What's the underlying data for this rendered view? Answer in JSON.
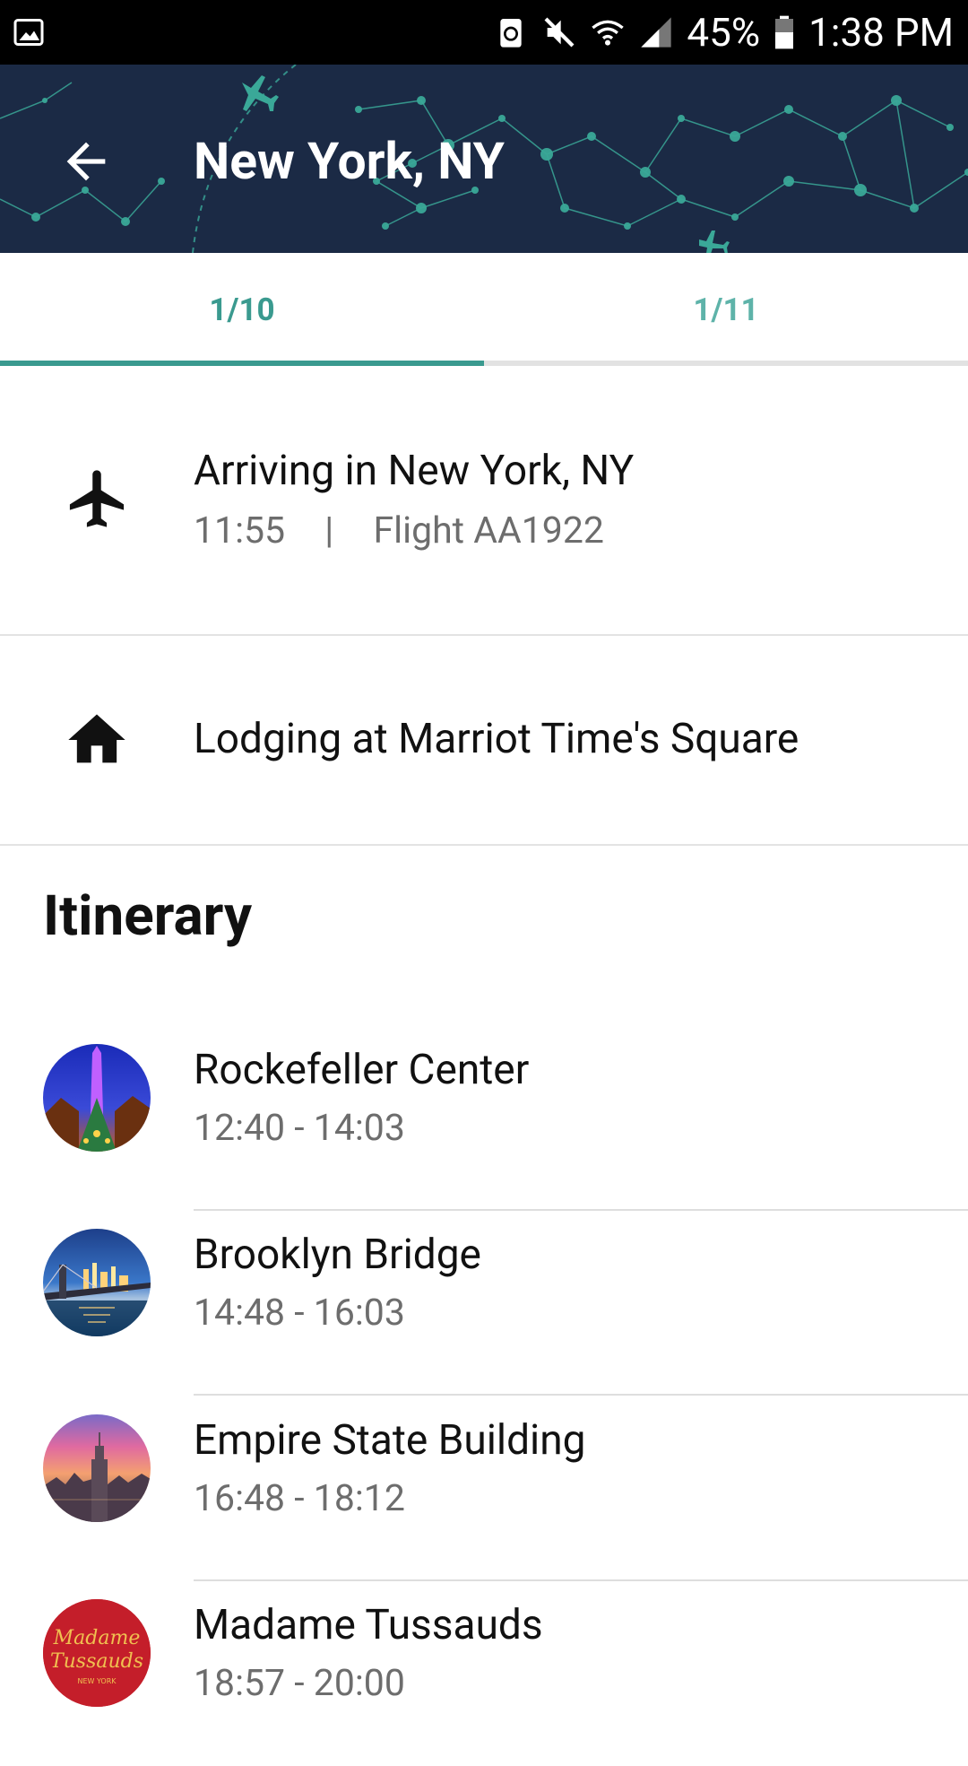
{
  "status_bar": {
    "battery_percent": "45%",
    "time": "1:38 PM",
    "icons": [
      "image-icon",
      "recycle-icon",
      "mute-icon",
      "wifi-icon",
      "signal-icon",
      "battery-icon"
    ]
  },
  "header": {
    "title": "New York, NY",
    "back_icon": "arrow-left-icon",
    "background_color": "#1b2a45",
    "accent_color": "#3aa898"
  },
  "tabs": [
    {
      "label": "1/10",
      "selected": true
    },
    {
      "label": "1/11",
      "selected": false
    }
  ],
  "arrival": {
    "icon": "airplane-icon",
    "title": "Arriving in New York, NY",
    "time": "11:55",
    "separator": "|",
    "flight": "Flight AA1922"
  },
  "lodging": {
    "icon": "home-icon",
    "title": "Lodging at Marriot Time's Square"
  },
  "itinerary": {
    "heading": "Itinerary",
    "items": [
      {
        "name": "Rockefeller Center",
        "time": "12:40 - 14:03"
      },
      {
        "name": "Brooklyn Bridge",
        "time": "14:48 - 16:03"
      },
      {
        "name": "Empire State Building",
        "time": "16:48 - 18:12"
      },
      {
        "name": "Madame Tussauds",
        "time": "18:57 - 20:00",
        "logo_text": "Madame Tussauds",
        "logo_subtext": "NEW YORK"
      }
    ]
  }
}
